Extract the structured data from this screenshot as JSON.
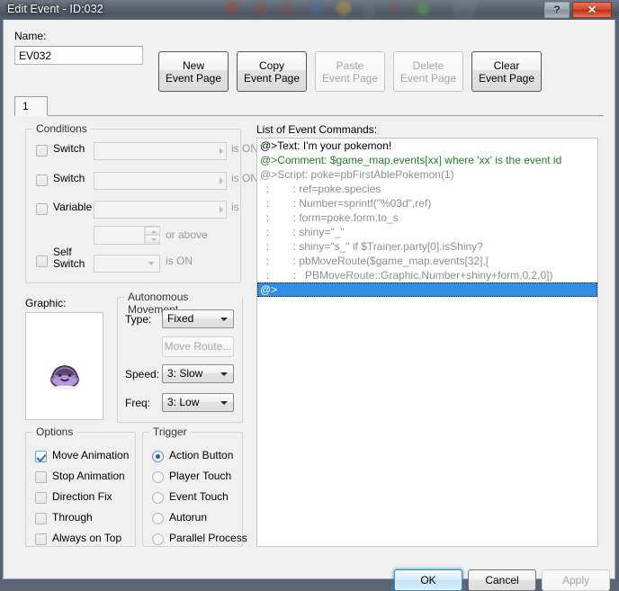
{
  "window": {
    "title": "Edit Event - ID:032",
    "help_button": "?",
    "close_button": "✕"
  },
  "name_field": {
    "label": "Name:",
    "value": "EV032",
    "placeholder": ""
  },
  "page_buttons": [
    {
      "label_top": "New",
      "label_bottom": "Event Page",
      "enabled": true
    },
    {
      "label_top": "Copy",
      "label_bottom": "Event Page",
      "enabled": true
    },
    {
      "label_top": "Paste",
      "label_bottom": "Event Page",
      "enabled": false
    },
    {
      "label_top": "Delete",
      "label_bottom": "Event Page",
      "enabled": false
    },
    {
      "label_top": "Clear",
      "label_bottom": "Event Page",
      "enabled": true
    }
  ],
  "tabs": [
    {
      "label": "1",
      "selected": true
    }
  ],
  "conditions": {
    "title": "Conditions",
    "rows": [
      {
        "label": "Switch",
        "checked": false,
        "value": "",
        "suffix": "is ON"
      },
      {
        "label": "Switch",
        "checked": false,
        "value": "",
        "suffix": "is ON"
      },
      {
        "label": "Variable",
        "checked": false,
        "value": "",
        "suffix": "is"
      },
      {
        "label": "Self Switch",
        "checked": false,
        "value": "",
        "suffix": "is ON"
      }
    ],
    "variable_spinner": {
      "value": "",
      "suffix": "or above"
    }
  },
  "graphic": {
    "label": "Graphic:",
    "sprite_name": "ditto-purple-sprite"
  },
  "autonomous_movement": {
    "title": "Autonomous Movement",
    "type_label": "Type:",
    "type_value": "Fixed",
    "move_route_label": "Move Route...",
    "move_route_enabled": false,
    "speed_label": "Speed:",
    "speed_value": "3: Slow",
    "freq_label": "Freq:",
    "freq_value": "3: Low"
  },
  "options": {
    "title": "Options",
    "items": [
      {
        "label": "Move Animation",
        "checked": true
      },
      {
        "label": "Stop Animation",
        "checked": false
      },
      {
        "label": "Direction Fix",
        "checked": false
      },
      {
        "label": "Through",
        "checked": false
      },
      {
        "label": "Always on Top",
        "checked": false
      }
    ]
  },
  "trigger": {
    "title": "Trigger",
    "items": [
      {
        "label": "Action Button",
        "selected": true
      },
      {
        "label": "Player Touch",
        "selected": false
      },
      {
        "label": "Event Touch",
        "selected": false
      },
      {
        "label": "Autorun",
        "selected": false
      },
      {
        "label": "Parallel Process",
        "selected": false
      }
    ]
  },
  "command_list": {
    "label": "List of Event Commands:",
    "lines": [
      {
        "text": "@>Text: I'm your pokemon!",
        "style": "normal",
        "selected": false
      },
      {
        "text": "@>Comment: $game_map.events[xx] where 'xx' is the event id",
        "style": "comment",
        "selected": false
      },
      {
        "text": "@>Script: poke=pbFirstAblePokemon(1)",
        "style": "script",
        "selected": false
      },
      {
        "text": "  :        : ref=poke.species",
        "style": "script",
        "selected": false
      },
      {
        "text": "  :        : Number=sprintf(\"%03d\",ref)",
        "style": "script",
        "selected": false
      },
      {
        "text": "  :        : form=poke.form.to_s",
        "style": "script",
        "selected": false
      },
      {
        "text": "  :        : shiny=\"_\"",
        "style": "script",
        "selected": false
      },
      {
        "text": "  :        : shiny=\"s_\" if $Trainer.party[0].isShiny?",
        "style": "script",
        "selected": false
      },
      {
        "text": "  :        : pbMoveRoute($game_map.events[32],[",
        "style": "script",
        "selected": false
      },
      {
        "text": "  :        :   PBMoveRoute::Graphic,Number+shiny+form,0,2,0])",
        "style": "script",
        "selected": false
      },
      {
        "text": "@>",
        "style": "normal",
        "selected": true
      }
    ]
  },
  "dialog_buttons": {
    "ok": "OK",
    "cancel": "Cancel",
    "apply": "Apply",
    "apply_enabled": false
  },
  "colors": {
    "accent_selection": "#2f8fe0",
    "comment_text": "#238023",
    "script_text": "#8f8f8f",
    "close_button": "#d3492b"
  }
}
